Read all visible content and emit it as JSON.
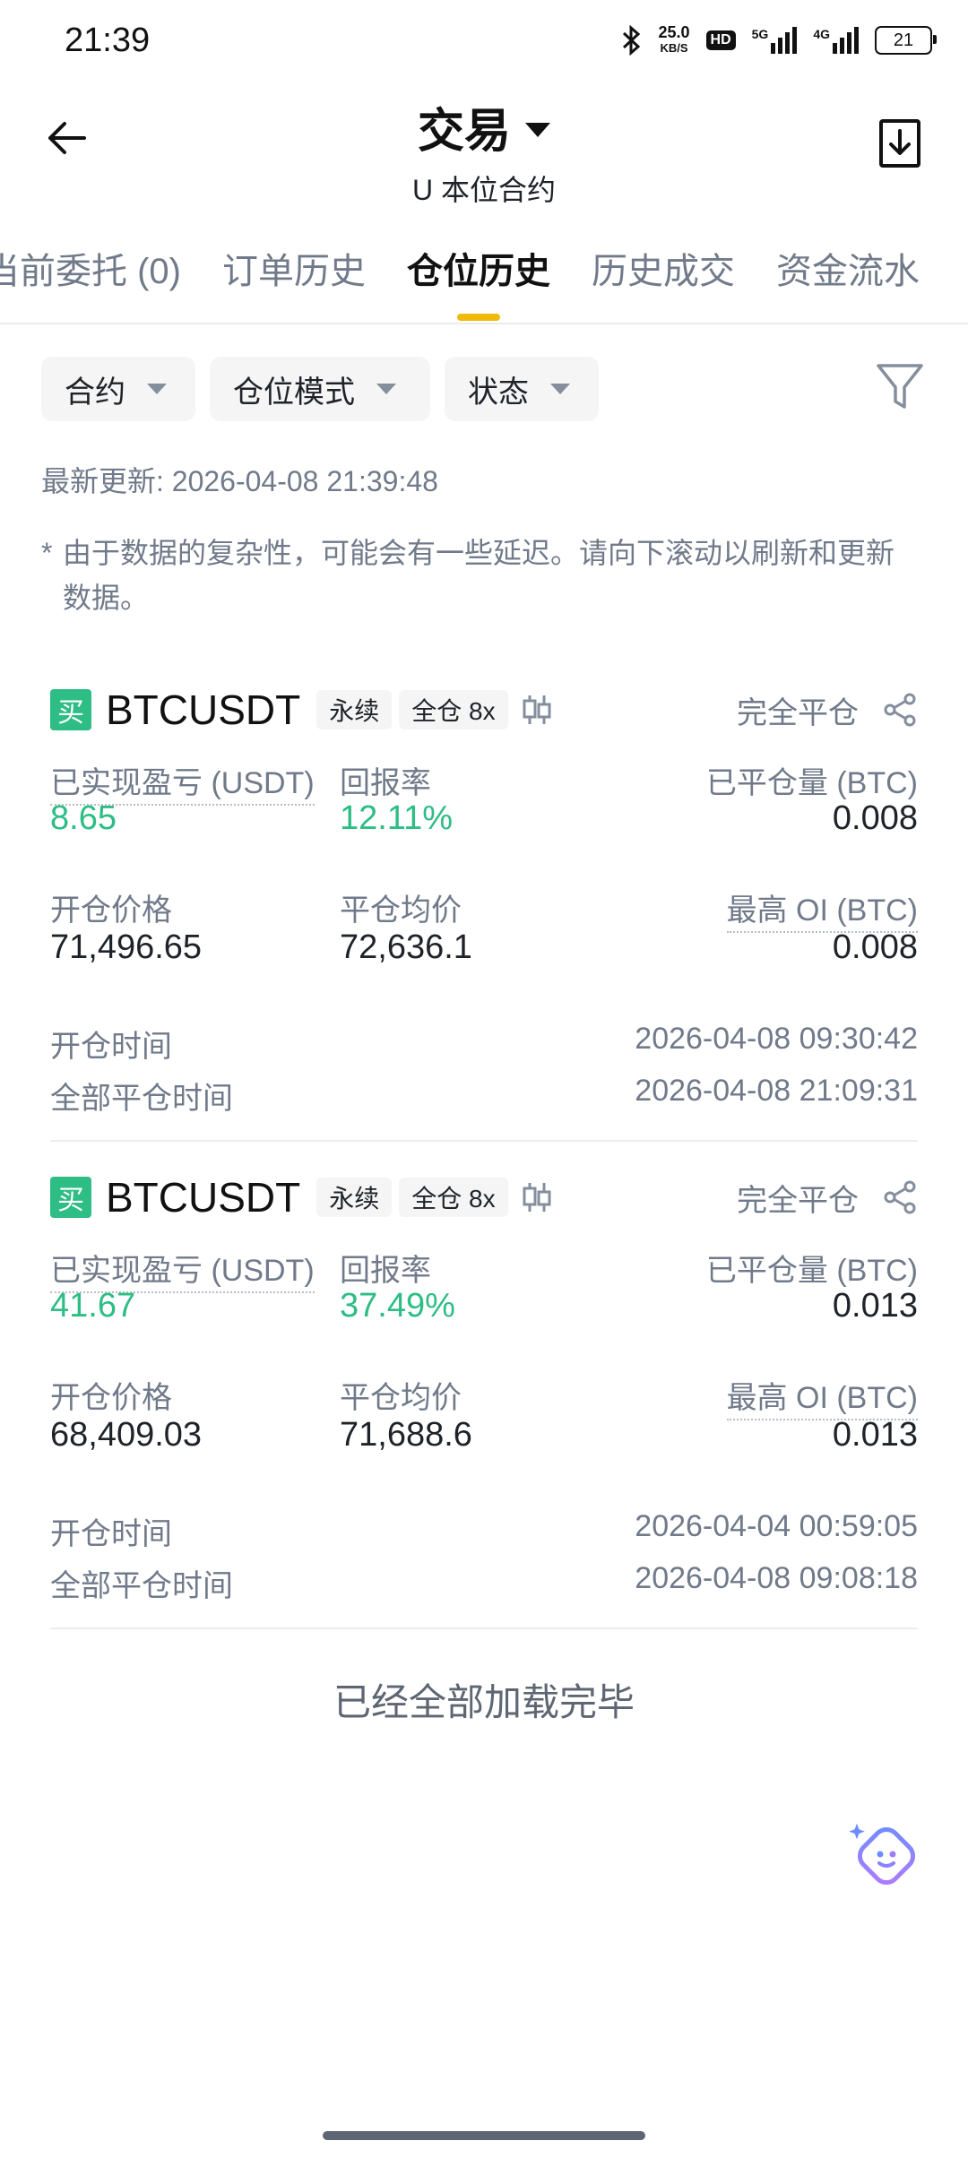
{
  "status_bar": {
    "time": "21:39",
    "net_speed": "25.0",
    "net_unit": "KB/S",
    "hd": "HD",
    "sig1": "5G",
    "sig2": "4G",
    "battery": "21"
  },
  "header": {
    "title": "交易",
    "subtitle": "U 本位合约"
  },
  "tabs": [
    {
      "label": "当前委托 (0)"
    },
    {
      "label": "订单历史"
    },
    {
      "label": "仓位历史",
      "active": true
    },
    {
      "label": "历史成交"
    },
    {
      "label": "资金流水"
    }
  ],
  "filters": {
    "contract": "合约",
    "position_mode": "仓位模式",
    "status": "状态"
  },
  "last_update": "最新更新: 2026-04-08 21:39:48",
  "note_star": "*",
  "note": "由于数据的复杂性，可能会有一些延迟。请向下滚动以刷新和更新数据。",
  "positions": [
    {
      "side": "买",
      "symbol": "BTCUSDT",
      "type": "永续",
      "margin": "全仓 8x",
      "status": "完全平仓",
      "pnl_label": "已实现盈亏 (USDT)",
      "pnl": "8.65",
      "roi_label": "回报率",
      "roi": "12.11%",
      "closed_qty_label": "已平仓量 (BTC)",
      "closed_qty": "0.008",
      "open_price_label": "开仓价格",
      "open_price": "71,496.65",
      "close_avg_label": "平仓均价",
      "close_avg": "72,636.1",
      "max_oi_label": "最高 OI (BTC)",
      "max_oi": "0.008",
      "open_time_label": "开仓时间",
      "open_time": "2026-04-08 09:30:42",
      "close_time_label": "全部平仓时间",
      "close_time": "2026-04-08 21:09:31"
    },
    {
      "side": "买",
      "symbol": "BTCUSDT",
      "type": "永续",
      "margin": "全仓 8x",
      "status": "完全平仓",
      "pnl_label": "已实现盈亏 (USDT)",
      "pnl": "41.67",
      "roi_label": "回报率",
      "roi": "37.49%",
      "closed_qty_label": "已平仓量 (BTC)",
      "closed_qty": "0.013",
      "open_price_label": "开仓价格",
      "open_price": "68,409.03",
      "close_avg_label": "平仓均价",
      "close_avg": "71,688.6",
      "max_oi_label": "最高 OI (BTC)",
      "max_oi": "0.013",
      "open_time_label": "开仓时间",
      "open_time": "2026-04-04 00:59:05",
      "close_time_label": "全部平仓时间",
      "close_time": "2026-04-08 09:08:18"
    }
  ],
  "footer": "已经全部加载完毕",
  "colors": {
    "accent": "#f0b90b",
    "profit": "#2ebd85",
    "muted": "#707a8a"
  }
}
